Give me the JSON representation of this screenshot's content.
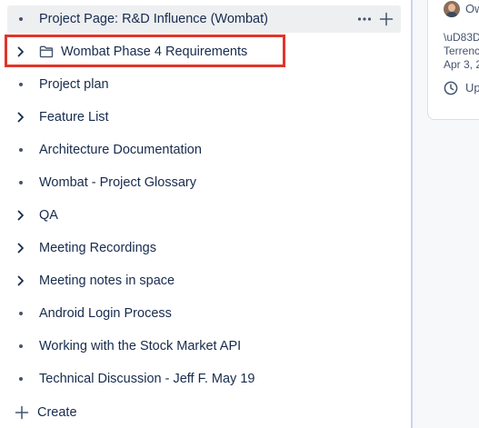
{
  "tree": {
    "items": [
      {
        "label": "Project Page: R&D Influence (Wombat)",
        "lead": "bullet",
        "hovered": true
      },
      {
        "label": "Wombat Phase 4 Requirements",
        "lead": "chevron",
        "folder": true,
        "highlighted": true
      },
      {
        "label": "Project plan",
        "lead": "bullet"
      },
      {
        "label": "Feature List",
        "lead": "chevron"
      },
      {
        "label": "Architecture Documentation",
        "lead": "bullet"
      },
      {
        "label": "Wombat - Project Glossary",
        "lead": "bullet"
      },
      {
        "label": "QA",
        "lead": "chevron"
      },
      {
        "label": "Meeting Recordings",
        "lead": "chevron"
      },
      {
        "label": "Meeting notes in space",
        "lead": "chevron"
      },
      {
        "label": "Android Login Process",
        "lead": "bullet"
      },
      {
        "label": "Working with the Stock Market API",
        "lead": "bullet"
      },
      {
        "label": "Technical Discussion - Jeff F. May 19",
        "lead": "bullet"
      }
    ],
    "create_label": "Create"
  },
  "right_panel": {
    "owner_label": "Ow",
    "line1": "\\uD83D",
    "line2": "Terrenc",
    "line3": "Apr 3, 2",
    "updated_label": "Up"
  },
  "colors": {
    "highlight": "#e0352b",
    "hover_bg": "#eeeff1",
    "text": "#172b4d",
    "divider": "#c8d3f5"
  }
}
